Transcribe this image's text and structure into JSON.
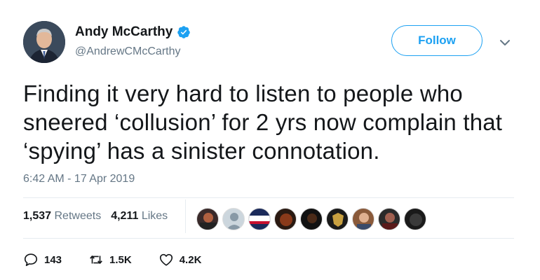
{
  "tweet": {
    "author_name": "Andy McCarthy",
    "author_handle": "@AndrewCMcCarthy",
    "verified": true,
    "follow_label": "Follow",
    "text": "Finding it very hard to listen to people who sneered ‘collusion’ for 2 yrs now complain that ‘spying’ has a sinister connotation.",
    "timestamp": "6:42 AM - 17 Apr 2019"
  },
  "stats": {
    "retweets_count": "1,537",
    "retweets_label": "Retweets",
    "likes_count": "4,211",
    "likes_label": "Likes"
  },
  "likers": [
    "liker-1",
    "liker-2",
    "liker-3",
    "liker-4",
    "liker-5",
    "liker-6",
    "liker-7",
    "liker-8",
    "liker-9"
  ],
  "actions": {
    "reply_count": "143",
    "retweet_count": "1.5K",
    "like_count": "4.2K"
  },
  "colors": {
    "accent": "#1da1f2",
    "secondary_text": "#657786",
    "divider": "#e6ecf0"
  },
  "icons": [
    "verified-badge-icon",
    "chevron-down-icon",
    "reply-icon",
    "retweet-icon",
    "heart-icon"
  ]
}
